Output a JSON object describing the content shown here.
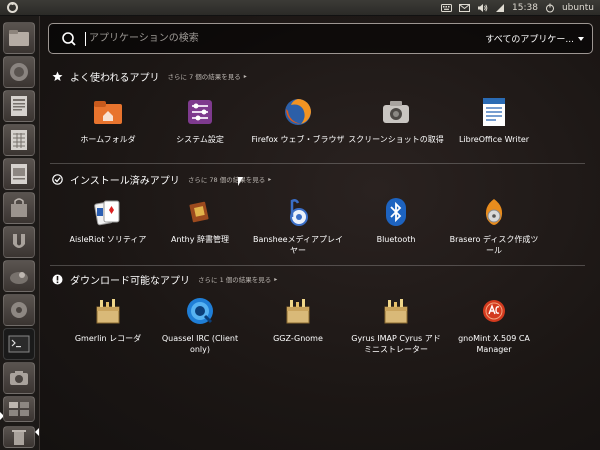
{
  "top_panel": {
    "clock": "15:38",
    "user": "ubuntu",
    "indicators": [
      "keyboard-icon",
      "mail-icon",
      "volume-icon",
      "network-icon"
    ]
  },
  "launcher": {
    "items": [
      {
        "icon": "home-folder-icon",
        "glyph": "⌂"
      },
      {
        "icon": "firefox-icon",
        "glyph": "●"
      },
      {
        "icon": "writer-icon",
        "glyph": "☰"
      },
      {
        "icon": "calc-icon",
        "glyph": "▦"
      },
      {
        "icon": "impress-icon",
        "glyph": "▤"
      },
      {
        "icon": "software-center-icon",
        "glyph": "⚙"
      },
      {
        "icon": "ubuntu-one-icon",
        "glyph": "U"
      },
      {
        "icon": "tools-icon",
        "glyph": "✦"
      },
      {
        "icon": "settings-icon",
        "glyph": "⚙"
      },
      {
        "icon": "terminal-icon",
        "glyph": ">_"
      },
      {
        "icon": "screenshot-icon",
        "glyph": "◉"
      },
      {
        "icon": "workspace-icon",
        "glyph": "▭"
      },
      {
        "icon": "trash-icon",
        "glyph": "▯"
      }
    ]
  },
  "search": {
    "placeholder": "アプリケーションの検索",
    "filter_label": "すべてのアプリケー..."
  },
  "categories": [
    {
      "title": "よく使われるアプリ",
      "more": "さらに 7 個の結果を見る",
      "icon": "star-icon",
      "apps": [
        {
          "label": "ホームフォルダ",
          "icon": "home-folder-icon"
        },
        {
          "label": "システム設定",
          "icon": "system-settings-icon"
        },
        {
          "label": "Firefox ウェブ・ブラウザ",
          "icon": "firefox-icon"
        },
        {
          "label": "スクリーンショットの取得",
          "icon": "screenshot-icon"
        },
        {
          "label": "LibreOffice Writer",
          "icon": "writer-icon"
        }
      ]
    },
    {
      "title": "インストール済みアプリ",
      "more": "さらに 78 個の結果を見る",
      "icon": "check-icon",
      "apps": [
        {
          "label": "AisleRiot ソリティア",
          "icon": "cards-icon"
        },
        {
          "label": "Anthy 辞書管理",
          "icon": "dictionary-icon"
        },
        {
          "label": "Bansheeメディアプレイヤー",
          "icon": "banshee-icon"
        },
        {
          "label": "Bluetooth",
          "icon": "bluetooth-icon"
        },
        {
          "label": "Brasero ディスク作成ツール",
          "icon": "brasero-icon"
        }
      ]
    },
    {
      "title": "ダウンロード可能なアプリ",
      "more": "さらに 1 個の結果を見る",
      "icon": "download-icon",
      "apps": [
        {
          "label": "Gmerlin レコーダ",
          "icon": "package-icon"
        },
        {
          "label": "Quassel IRC (Client only)",
          "icon": "quassel-icon"
        },
        {
          "label": "GGZ-Gnome",
          "icon": "package-icon"
        },
        {
          "label": "Gyrus IMAP Cyrus アドミニストレーター",
          "icon": "package-icon"
        },
        {
          "label": "gnoMint X.509 CA Manager",
          "icon": "gnomint-icon"
        }
      ]
    }
  ]
}
